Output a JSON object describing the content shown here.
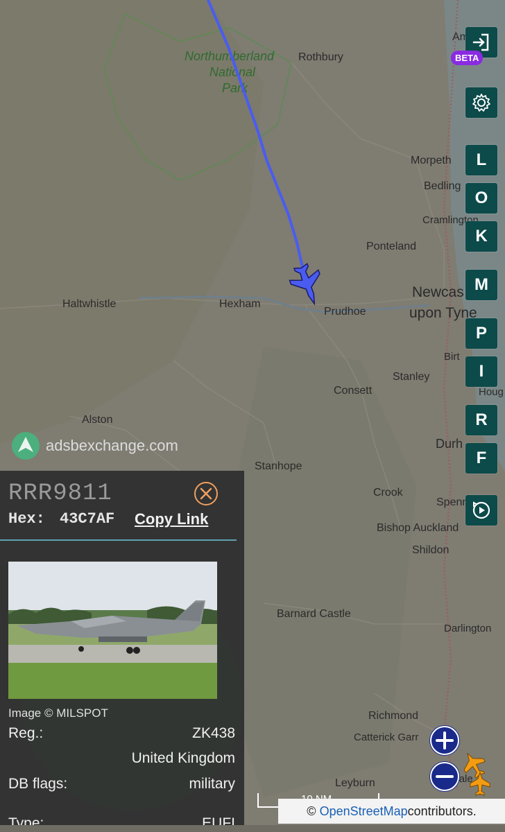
{
  "map": {
    "places": [
      {
        "id": "northumberland-park-1",
        "text": "Northumberland"
      },
      {
        "id": "northumberland-park-2",
        "text": "National"
      },
      {
        "id": "northumberland-park-3",
        "text": "Park"
      },
      {
        "id": "rothbury",
        "text": "Rothbury"
      },
      {
        "id": "ambl",
        "text": "Amb"
      },
      {
        "id": "morpeth",
        "text": "Morpeth"
      },
      {
        "id": "bedling",
        "text": "Bedling"
      },
      {
        "id": "cramlington",
        "text": "Cramlington"
      },
      {
        "id": "ponteland",
        "text": "Ponteland"
      },
      {
        "id": "newcastle-1",
        "text": "Newcas"
      },
      {
        "id": "newcastle-2",
        "text": "upon Tyne"
      },
      {
        "id": "haltwhistle",
        "text": "Haltwhistle"
      },
      {
        "id": "hexham",
        "text": "Hexham"
      },
      {
        "id": "prudhoe",
        "text": "Prudhoe"
      },
      {
        "id": "birt",
        "text": "Birt"
      },
      {
        "id": "stanley",
        "text": "Stanley"
      },
      {
        "id": "houg",
        "text": "Houg"
      },
      {
        "id": "consett",
        "text": "Consett"
      },
      {
        "id": "alston",
        "text": "Alston"
      },
      {
        "id": "durh",
        "text": "Durh"
      },
      {
        "id": "stanhope",
        "text": "Stanhope"
      },
      {
        "id": "crook",
        "text": "Crook"
      },
      {
        "id": "spennym",
        "text": "Spennym"
      },
      {
        "id": "bishop-auckland",
        "text": "Bishop Auckland"
      },
      {
        "id": "shildon",
        "text": "Shildon"
      },
      {
        "id": "barnard-castle",
        "text": "Barnard Castle"
      },
      {
        "id": "darlington",
        "text": "Darlington"
      },
      {
        "id": "richmond",
        "text": "Richmond"
      },
      {
        "id": "catterick",
        "text": "Catterick Garr"
      },
      {
        "id": "leyburn",
        "text": "Leyburn"
      },
      {
        "id": "bedale",
        "text": "Bedale"
      }
    ],
    "brand": "adsbexchange.com",
    "scale_label": "10 NM",
    "attribution_link": "OpenStreetMap",
    "attribution_rest": " contributors.",
    "attribution_prefix": "©",
    "track_color": "#4a5cf0",
    "aircraft_color": "#4a5cf0"
  },
  "controls": {
    "beta_label": "BETA",
    "letters": [
      "L",
      "O",
      "K",
      "M",
      "P",
      "I",
      "R",
      "F"
    ]
  },
  "panel": {
    "callsign": "RRR9811",
    "hex_label": "Hex:",
    "hex_value": "43C7AF",
    "copy_link": "Copy Link",
    "image_credit": "Image © MILSPOT",
    "rows": [
      {
        "key": "Reg.:",
        "value": "ZK438"
      },
      {
        "key": "",
        "value": "United Kingdom"
      },
      {
        "key": "DB flags:",
        "value": "military"
      },
      {
        "key": "Type:",
        "value": "EUFI"
      }
    ]
  }
}
